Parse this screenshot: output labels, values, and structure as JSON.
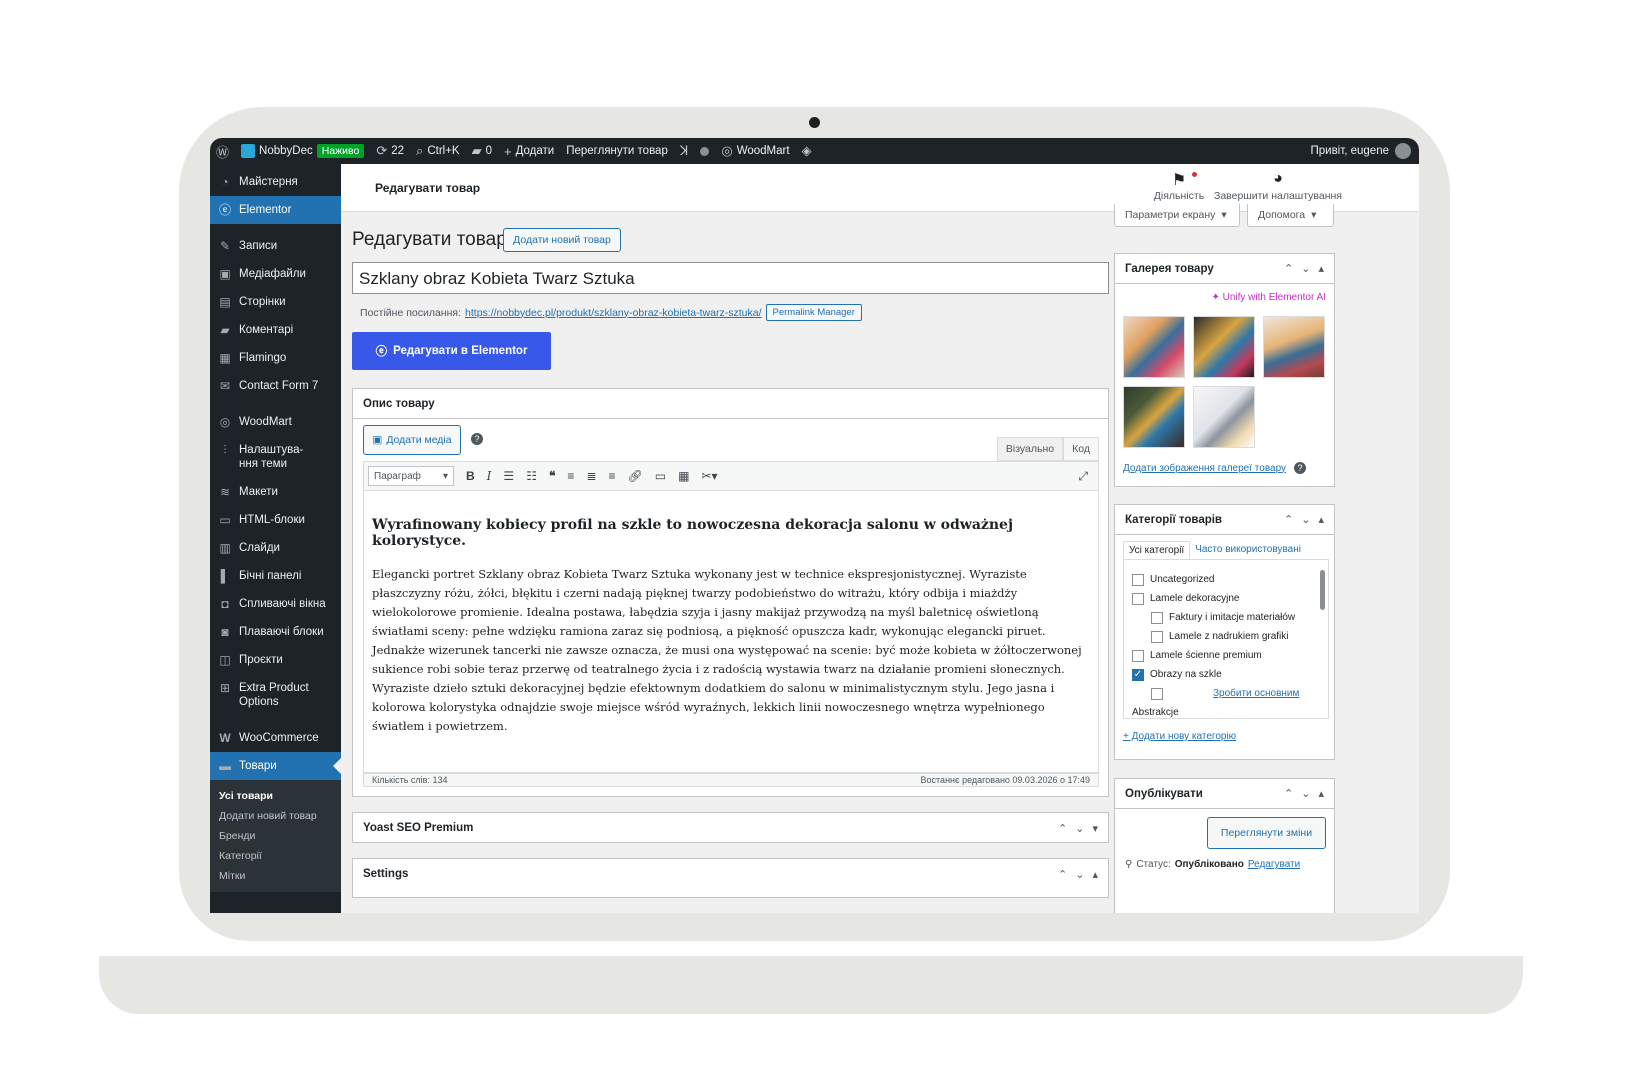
{
  "admin_bar": {
    "site_name": "NobbyDec",
    "live_badge": "Наживо",
    "updates_count": "22",
    "shortcut": "Ctrl+K",
    "comments_count": "0",
    "add_label": "Додати",
    "view_product": "Переглянути товар",
    "theme_name": "WoodMart",
    "greeting": "Привіт, eugene"
  },
  "sidebar": {
    "items": [
      {
        "label": "Майстерня",
        "icon": "dashboard-icon"
      },
      {
        "label": "Elementor",
        "icon": "elementor-icon"
      },
      {
        "label": "Записи",
        "icon": "pin-icon"
      },
      {
        "label": "Медіафайли",
        "icon": "media-icon"
      },
      {
        "label": "Сторінки",
        "icon": "pages-icon"
      },
      {
        "label": "Коментарі",
        "icon": "comment-icon"
      },
      {
        "label": "Flamingo",
        "icon": "flamingo-icon"
      },
      {
        "label": "Contact Form 7",
        "icon": "mail-icon"
      },
      {
        "label": "WoodMart",
        "icon": "woodmart-icon"
      },
      {
        "label": "Налаштува-\nння теми",
        "icon": "settings-sliders-icon"
      },
      {
        "label": "Макети",
        "icon": "layers-icon"
      },
      {
        "label": "HTML-блоки",
        "icon": "html-block-icon"
      },
      {
        "label": "Слайди",
        "icon": "slides-icon"
      },
      {
        "label": "Бічні панелі",
        "icon": "sidebar-panel-icon"
      },
      {
        "label": "Спливаючі вікна",
        "icon": "popup-icon"
      },
      {
        "label": "Плаваючі блоки",
        "icon": "floating-block-icon"
      },
      {
        "label": "Проєкти",
        "icon": "briefcase-icon"
      },
      {
        "label": "Extra Product Options",
        "icon": "cart-icon"
      },
      {
        "label": "WooCommerce",
        "icon": "woocommerce-icon"
      },
      {
        "label": "Товари",
        "icon": "products-icon"
      }
    ],
    "submenu": [
      "Усі товари",
      "Додати новий товар",
      "Бренди",
      "Категорії",
      "Мітки"
    ]
  },
  "topbar": {
    "title": "Редагувати товар",
    "activity": "Діяльність",
    "finish_setup": "Завершити налаштування",
    "screen_options": "Параметри екрану",
    "help": "Допомога"
  },
  "main": {
    "heading": "Редагувати товар",
    "add_new": "Додати новий товар",
    "product_title": "Szklany obraz Kobieta Twarz Sztuka",
    "permalink_label": "Постійне посилання:",
    "permalink_url": "https://nobbydec.pl/produkt/szklany-obraz-kobieta-twarz-sztuka/",
    "permalink_manager": "Permalink Manager",
    "edit_elementor": "Редагувати в Elementor",
    "description_box": "Опис товару",
    "add_media": "Додати медіа",
    "tab_visual": "Візуально",
    "tab_code": "Код",
    "format_select": "Параграф",
    "content_heading": "Wyrafinowany kobiecy profil na szkle to nowoczesna dekoracja salonu w odważnej kolorystyce.",
    "content_body": "Elegancki portret Szklany obraz Kobieta Twarz Sztuka wykonany jest w technice ekspresjonistycznej. Wyraziste płaszczyzny różu, żółci, błękitu i czerni nadają pięknej twarzy podobieństwo do witrażu, który odbija i miażdży wielokolorowe promienie. Idealna postawa, łabędzia szyja i jasny makijaż przywodzą na myśl baletnicę oświetloną światłami sceny: pełne wdzięku ramiona zaraz się podniosą, a piękność opuszcza kadr, wykonując elegancki piruet. Jednakże wizerunek tancerki nie zawsze oznacza, że musi ona występować na scenie: być może kobieta w żółtoczerwonej sukience robi sobie teraz przerwę od teatralnego życia i z radością wystawia twarz na działanie promieni słonecznych. Wyraziste dzieło sztuki dekoracyjnej będzie efektownym dodatkiem do salonu w minimalistycznym stylu. Jego jasna i kolorowa kolorystyka odnajdzie swoje miejsce wśród wyraźnych, lekkich linii nowoczesnego wnętrza wypełnionego światłem i powietrzem.",
    "word_count": "Кількість слів: 134",
    "last_edited": "Востаннє редаговано 09.03.2026 о 17:49",
    "yoast_box": "Yoast SEO Premium",
    "settings_box": "Settings"
  },
  "gallery": {
    "title": "Галерея товару",
    "unify": "Unify with Elementor AI",
    "add_images": "Додати зображення галереї товару"
  },
  "categories": {
    "title": "Категорії товарів",
    "tab_all": "Усі категорії",
    "tab_popular": "Часто використовувані",
    "items": [
      {
        "label": "Uncategorized",
        "checked": false,
        "indent": 0
      },
      {
        "label": "Lamele dekoracyjne",
        "checked": false,
        "indent": 0
      },
      {
        "label": "Faktury i imitacje materiałów",
        "checked": false,
        "indent": 1
      },
      {
        "label": "Lamele z nadrukiem grafiki",
        "checked": false,
        "indent": 1
      },
      {
        "label": "Lamele ścienne premium",
        "checked": false,
        "indent": 0
      },
      {
        "label": "Obrazy na szkle",
        "checked": true,
        "indent": 0
      }
    ],
    "make_primary": "Зробити основним",
    "abstract": "Abstrakcje",
    "add_new": "+ Додати нову категорію"
  },
  "publish": {
    "title": "Опублікувати",
    "preview_changes": "Переглянути зміни",
    "status_label": "Статус:",
    "status_value": "Опубліковано",
    "status_edit": "Редагувати"
  },
  "colors": {
    "admin_dark": "#1d2327",
    "accent_blue": "#2271b1",
    "elementor_blue": "#3858e9",
    "live_green": "#00a32a"
  }
}
